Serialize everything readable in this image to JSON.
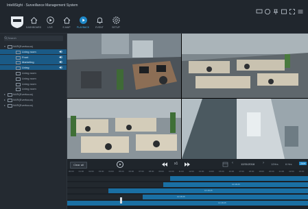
{
  "app": {
    "title": "IntelliSight · Surveillance Management System"
  },
  "nav": [
    {
      "label": "DASHBOARD",
      "icon": "home-icon"
    },
    {
      "label": "LIVE",
      "icon": "play-circle-icon"
    },
    {
      "label": "E-MAP",
      "icon": "map-icon"
    },
    {
      "label": "PLAYBACK",
      "icon": "playback-icon",
      "active": true
    },
    {
      "label": "EVENT",
      "icon": "bell-icon"
    },
    {
      "label": "SETUP",
      "icon": "gear-icon"
    }
  ],
  "sidebar": {
    "search_placeholder": "Search",
    "tree": [
      {
        "label": "NVR(Everfocus)",
        "level": 0,
        "expanded": true
      },
      {
        "label": "Living room",
        "level": 1,
        "selected": true,
        "audio": true
      },
      {
        "label": "Front",
        "level": 1,
        "selected": true,
        "audio": true
      },
      {
        "label": "Marketing",
        "level": 1,
        "selected": true,
        "audio": true
      },
      {
        "label": "Living",
        "level": 1,
        "selected": true,
        "audio": true
      },
      {
        "label": "Living room",
        "level": 1
      },
      {
        "label": "Living room",
        "level": 1
      },
      {
        "label": "Living room",
        "level": 1
      },
      {
        "label": "Living room",
        "level": 1
      },
      {
        "label": "NVR(Everfocus)",
        "level": 0
      },
      {
        "label": "NVR(Everfocus)",
        "level": 0
      },
      {
        "label": "NVR(Everfocus)",
        "level": 0
      }
    ]
  },
  "controls": {
    "clear_label": "Clear all",
    "speed": "x1",
    "date": "12/31/2018",
    "zoom_options": [
      "12Hrs",
      "6 Hrs",
      "24H"
    ],
    "accent": "#1f88c8"
  },
  "timeline": {
    "ticks": [
      "00:00",
      "01:00",
      "02:00",
      "03:00",
      "04:00",
      "05:00",
      "06:00",
      "07:00",
      "08:00",
      "09:00",
      "10:00",
      "11:00",
      "12:00",
      "13:00",
      "14:00",
      "15:00",
      "16:00",
      "17:00",
      "18:00",
      "19:00",
      "20:00",
      "21:00",
      "22:00",
      "23:00"
    ],
    "segment_label": "10:48:25"
  }
}
